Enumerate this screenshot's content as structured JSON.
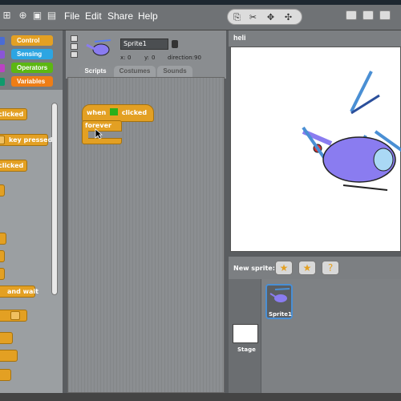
{
  "menu": [
    "File",
    "Edit",
    "Share",
    "Help"
  ],
  "categories": [
    {
      "label": "Control",
      "color": "#e3a023"
    },
    {
      "label": "Sensing",
      "color": "#2ca5e2"
    },
    {
      "label": "Operators",
      "color": "#5cb712"
    },
    {
      "label": "Variables",
      "color": "#ee7d16"
    }
  ],
  "palette_blocks": [
    "clicked",
    "key pressed",
    "clicked",
    "and wait"
  ],
  "sprite": {
    "name": "Sprite1",
    "x_label": "x:",
    "x_value": "0",
    "y_label": "y:",
    "y_value": "0",
    "direction_label": "direction:",
    "direction_value": "90"
  },
  "tabs": [
    "Scripts",
    "Costumes",
    "Sounds"
  ],
  "script": {
    "when": "when",
    "clicked": "clicked",
    "forever": "forever"
  },
  "stage": {
    "title": "heli",
    "new_sprite_label": "New sprite:",
    "stage_label": "Stage",
    "sprite_thumb_label": "Sprite1"
  }
}
